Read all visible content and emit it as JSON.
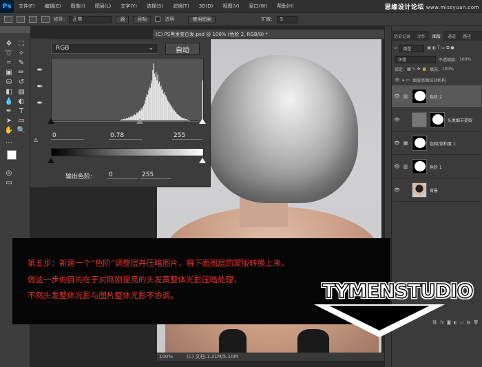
{
  "app": {
    "logo": "Ps"
  },
  "menu": [
    "文件(F)",
    "编辑(E)",
    "图像(I)",
    "图层(L)",
    "文字(Y)",
    "选择(S)",
    "滤镜(T)",
    "3D(D)",
    "视图(V)",
    "窗口(W)",
    "帮助(H)"
  ],
  "watermark": {
    "brand": "思缘设计论坛",
    "url": "www.missyuan.com"
  },
  "options": {
    "feather_label": "修补:",
    "mode_value": "正常",
    "source_btn": "源",
    "target_btn": "目标",
    "transparent_label": "透明",
    "use_pattern_btn": "使用图案",
    "diffusion_label": "扩散:",
    "diffusion_value": "5"
  },
  "document": {
    "tab_title": "(C) PS黑发变白发.psd @ 100% (色阶 2, RGB/8) *",
    "zoom": "100%",
    "doc_info": "(C) 文档:1.31M/5.10M"
  },
  "levels": {
    "channel": "RGB",
    "auto_label": "自动",
    "input_black": "0",
    "input_mid": "0.78",
    "input_white": "255",
    "output_label": "输出色阶:",
    "output_black": "0",
    "output_white": "255",
    "histogram": [
      0,
      0,
      0,
      0,
      0,
      0,
      0,
      0,
      0,
      0,
      0,
      0,
      0,
      0,
      0,
      0,
      0,
      0,
      0,
      0,
      0,
      0,
      0,
      0,
      0,
      0,
      0,
      0,
      0,
      0,
      0,
      0,
      0,
      0,
      0,
      0,
      0,
      0,
      0,
      0,
      0,
      0,
      0,
      0,
      0,
      0,
      0,
      0,
      0,
      0,
      0,
      0,
      0,
      0,
      0,
      0,
      0,
      0,
      0,
      0,
      0,
      0,
      0,
      0,
      0,
      0,
      0,
      0,
      0,
      0,
      0,
      0,
      0,
      0,
      0,
      0,
      0,
      0,
      0,
      0,
      0,
      0,
      1,
      1,
      2,
      1,
      2,
      3,
      2,
      3,
      4,
      3,
      5,
      4,
      6,
      5,
      7,
      6,
      8,
      9,
      8,
      10,
      12,
      11,
      13,
      15,
      14,
      18,
      16,
      20,
      22,
      25,
      30,
      35,
      40,
      38,
      45,
      50,
      48,
      55,
      60,
      75,
      85,
      70,
      65,
      72,
      60,
      68,
      55,
      58,
      50,
      52,
      45,
      47,
      40,
      42,
      38,
      36,
      33,
      30,
      28,
      26,
      24,
      22,
      20,
      18,
      16,
      15,
      13,
      12,
      10,
      9,
      8,
      7,
      6,
      5,
      4,
      4,
      3,
      3,
      2,
      2,
      2,
      1,
      1,
      1,
      0,
      0,
      0,
      0,
      0,
      0,
      0,
      0,
      0,
      0,
      0,
      0,
      0,
      0,
      0,
      60
    ]
  },
  "panels": {
    "tabs": [
      "历史记录",
      "动作",
      "图层",
      "通道",
      "路径"
    ],
    "kind_label": "类型",
    "blend_mode": "正常",
    "opacity_label": "不透明度:",
    "opacity_value": "100%",
    "lock_label": "锁定:",
    "fill_label": "填充:",
    "fill_value": "100%",
    "group_name": "图层修图培训机构",
    "layers": [
      {
        "name": "色阶 2",
        "selected": true
      },
      {
        "name": "头发细节提取",
        "selected": false
      },
      {
        "name": "色相/饱和度 1",
        "selected": false
      },
      {
        "name": "色阶 1",
        "selected": false
      },
      {
        "name": "背景",
        "selected": false
      }
    ],
    "footer": "fx"
  },
  "caption": {
    "line1": "第五步：新建一个“色阶”调整层并压暗图片，将下面图层的蒙版转换上来。",
    "line2": "做这一步的目的在于对刚刚提亮的头发黄整体光影压暗处理，",
    "line3": "不然头发整体光影与图片整体光影不协调。"
  },
  "logo": {
    "text": "TYMENSTUDIO"
  }
}
